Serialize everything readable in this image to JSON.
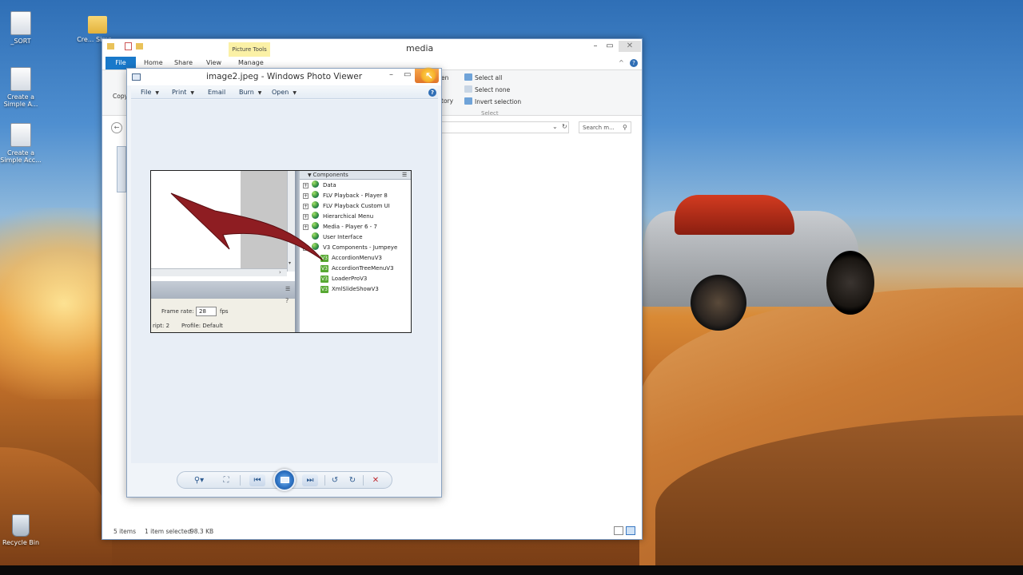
{
  "desktop": {
    "icons": [
      {
        "label": "_SORT",
        "kind": "document"
      },
      {
        "label": "Cre... Simp...",
        "kind": "folder"
      },
      {
        "label": "Create a Simple A...",
        "kind": "document"
      },
      {
        "label": "Create a Simple Acc...",
        "kind": "document"
      },
      {
        "label": "Recycle Bin",
        "kind": "recycle-bin"
      }
    ]
  },
  "explorer": {
    "title": "media",
    "tabs": {
      "file": "File",
      "home": "Home",
      "share": "Share",
      "view": "View",
      "manage": "Manage",
      "contextual": "Picture Tools"
    },
    "ribbon": {
      "copy": "Copy",
      "open_partial": "en",
      "history_partial": "tory",
      "select_all": "Select all",
      "select_none": "Select none",
      "invert_selection": "Invert selection",
      "group_select": "Select"
    },
    "search_placeholder": "Search m...",
    "status": {
      "items": "5 items",
      "selected": "1 item selected",
      "size": "98.3 KB"
    }
  },
  "viewer": {
    "title": "image2.jpeg - Windows Photo Viewer",
    "menu": [
      "File",
      "Print",
      "Email",
      "Burn",
      "Open"
    ],
    "image": {
      "components_header": "Components",
      "tree": [
        {
          "label": "Data",
          "expand": true,
          "icon": "gem"
        },
        {
          "label": "FLV Playback - Player 8",
          "expand": true,
          "icon": "gem"
        },
        {
          "label": "FLV Playback Custom UI",
          "expand": true,
          "icon": "gem"
        },
        {
          "label": "Hierarchical Menu",
          "expand": true,
          "icon": "gem"
        },
        {
          "label": "Media - Player 6 - 7",
          "expand": true,
          "icon": "gem"
        },
        {
          "label": "User Interface",
          "expand": false,
          "icon": "gem"
        },
        {
          "label": "V3 Components - Jumpeye",
          "expand": true,
          "icon": "gem"
        },
        {
          "label": "AccordionMenuV3",
          "expand": false,
          "icon": "v3"
        },
        {
          "label": "AccordionTreeMenuV3",
          "expand": false,
          "icon": "v3"
        },
        {
          "label": "LoaderProV3",
          "expand": false,
          "icon": "v3"
        },
        {
          "label": "XmlSlideShowV3",
          "expand": false,
          "icon": "v3"
        }
      ],
      "frame_rate_label": "Frame rate:",
      "frame_rate_value": "28",
      "fps": "fps",
      "script_label": "ript:  2",
      "profile_label": "Profile:  Default",
      "v3_badge": "V3"
    },
    "controls": {
      "zoom": "⚲▾",
      "fit": "⛶",
      "prev": "⏮",
      "next": "⏭",
      "rotate_ccw": "↺",
      "rotate_cw": "↻",
      "delete": "✕"
    },
    "accent_color": "#2e73c4",
    "close_highlight_color": "#f6b32a"
  }
}
